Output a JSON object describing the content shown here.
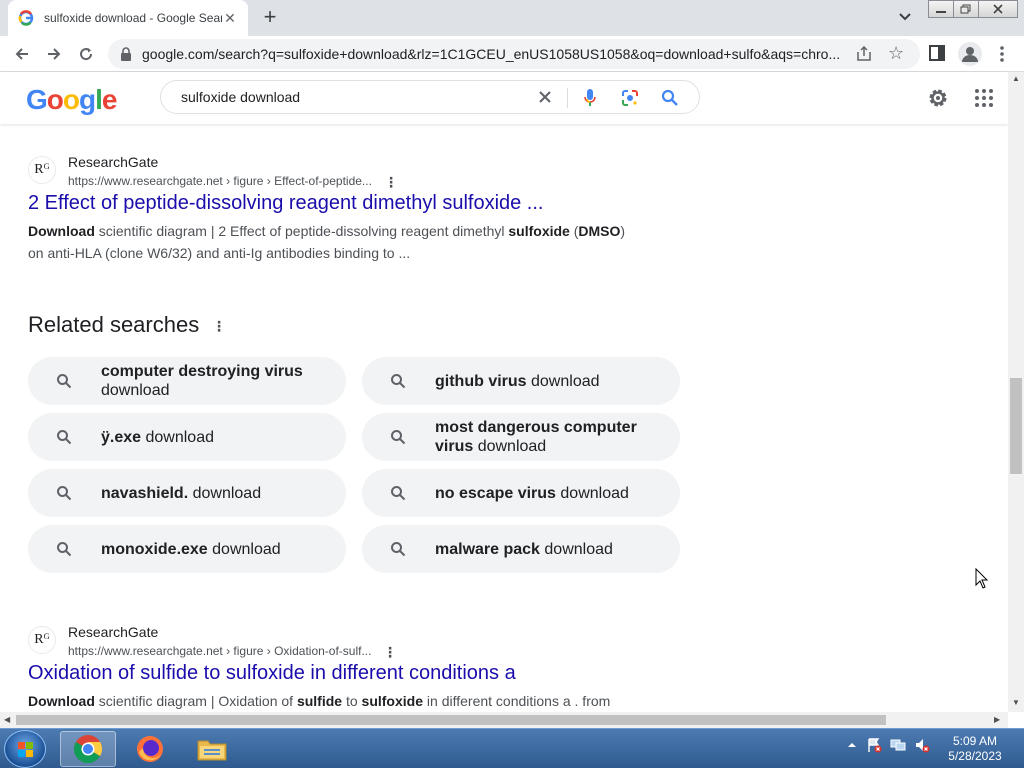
{
  "browser": {
    "tab_title": "sulfoxide download - Google Search",
    "url": "google.com/search?q=sulfoxide+download&rlz=1C1GCEU_enUS1058US1058&oq=download+sulfo&aqs=chro..."
  },
  "google": {
    "logo": "Google",
    "query": "sulfoxide download"
  },
  "results": [
    {
      "favicon": "Rᴳ",
      "site": "ResearchGate",
      "url": "https://www.researchgate.net › figure › Effect-of-peptide...",
      "title": "2 Effect of peptide-dissolving reagent dimethyl sulfoxide ...",
      "snippet_parts": [
        {
          "t": "Download",
          "b": true
        },
        {
          "t": " scientific diagram | 2 Effect of peptide-dissolving reagent dimethyl ",
          "b": false
        },
        {
          "t": "sulfoxide",
          "b": true
        },
        {
          "t": " (",
          "b": false
        },
        {
          "t": "DMSO",
          "b": true
        },
        {
          "t": ") on anti-HLA (clone W6/32) and anti-Ig antibodies binding to ...",
          "b": false
        }
      ]
    },
    {
      "favicon": "Rᴳ",
      "site": "ResearchGate",
      "url": "https://www.researchgate.net › figure › Oxidation-of-sulf...",
      "title": "Oxidation of sulfide to sulfoxide in different conditions a",
      "snippet_parts": [
        {
          "t": "Download",
          "b": true
        },
        {
          "t": " scientific diagram | Oxidation of ",
          "b": false
        },
        {
          "t": "sulfide",
          "b": true
        },
        {
          "t": " to ",
          "b": false
        },
        {
          "t": "sulfoxide",
          "b": true
        },
        {
          "t": " in different conditions a . from",
          "b": false
        }
      ]
    }
  ],
  "related": {
    "title": "Related searches",
    "items": [
      {
        "bold": "computer destroying virus",
        "rest": " download"
      },
      {
        "bold": "github virus",
        "rest": " download"
      },
      {
        "bold": "ÿ.exe",
        "rest": " download"
      },
      {
        "bold": "most dangerous computer virus",
        "rest": " download"
      },
      {
        "bold": "navashield.",
        "rest": " download"
      },
      {
        "bold": "no escape virus",
        "rest": " download"
      },
      {
        "bold": "monoxide.exe",
        "rest": " download"
      },
      {
        "bold": "malware pack",
        "rest": " download"
      }
    ]
  },
  "taskbar": {
    "time": "5:09 AM",
    "date": "5/28/2023"
  },
  "colors": {
    "link": "#1a0dab",
    "chip_bg": "#f1f3f4",
    "google_blue": "#4285f4",
    "google_red": "#ea4335",
    "google_yellow": "#fbbc05",
    "google_green": "#34a853"
  }
}
